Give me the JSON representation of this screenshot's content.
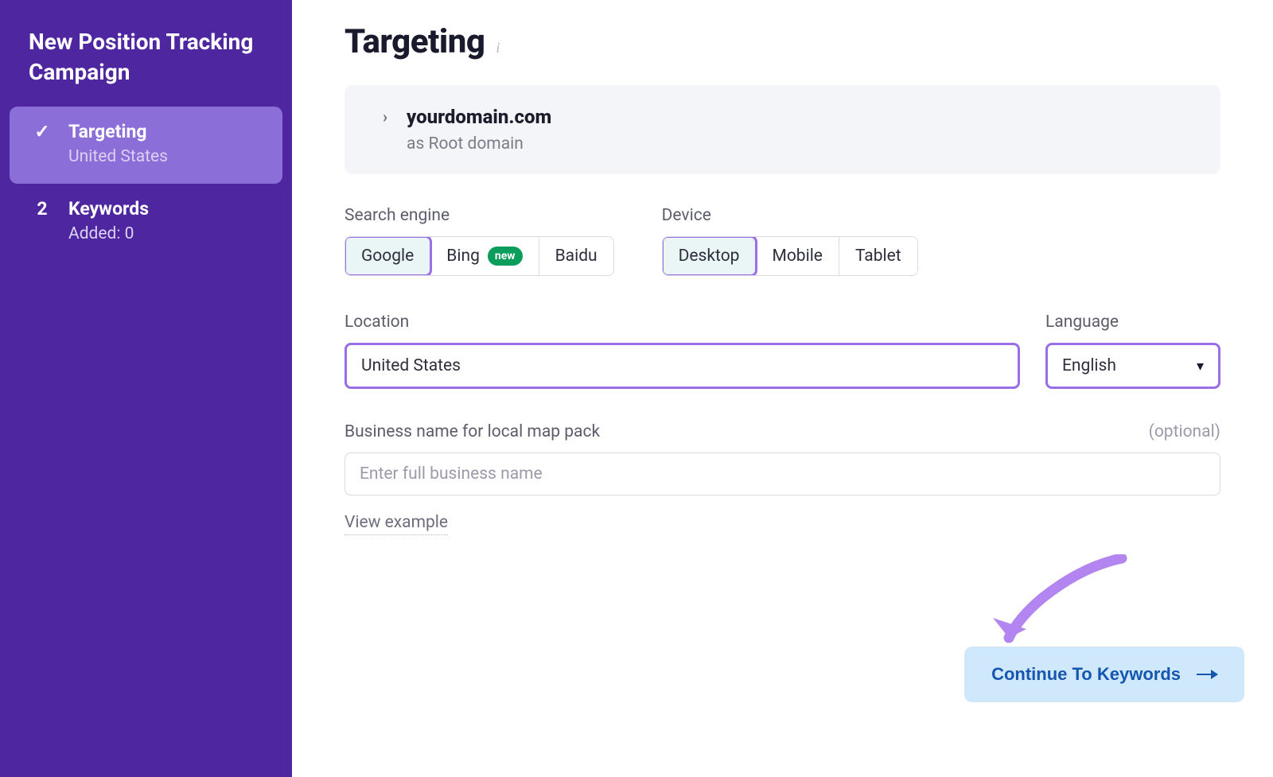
{
  "sidebar": {
    "title": "New Position Tracking Campaign",
    "steps": [
      {
        "label": "Targeting",
        "sub": "United States",
        "marker": "✓",
        "active": true
      },
      {
        "label": "Keywords",
        "sub": "Added: 0",
        "marker": "2",
        "active": false
      }
    ]
  },
  "page_title": "Targeting",
  "domain_panel": {
    "domain": "yourdomain.com",
    "sub": "as Root domain"
  },
  "search_engine": {
    "label": "Search engine",
    "options": [
      "Google",
      "Bing",
      "Baidu"
    ],
    "selected": "Google",
    "new_badge_on": "Bing",
    "new_badge_text": "new"
  },
  "device": {
    "label": "Device",
    "options": [
      "Desktop",
      "Mobile",
      "Tablet"
    ],
    "selected": "Desktop"
  },
  "location": {
    "label": "Location",
    "value": "United States"
  },
  "language": {
    "label": "Language",
    "value": "English"
  },
  "business": {
    "label": "Business name for local map pack",
    "optional_text": "(optional)",
    "placeholder": "Enter full business name"
  },
  "view_example_label": "View example",
  "continue_label": "Continue To Keywords"
}
